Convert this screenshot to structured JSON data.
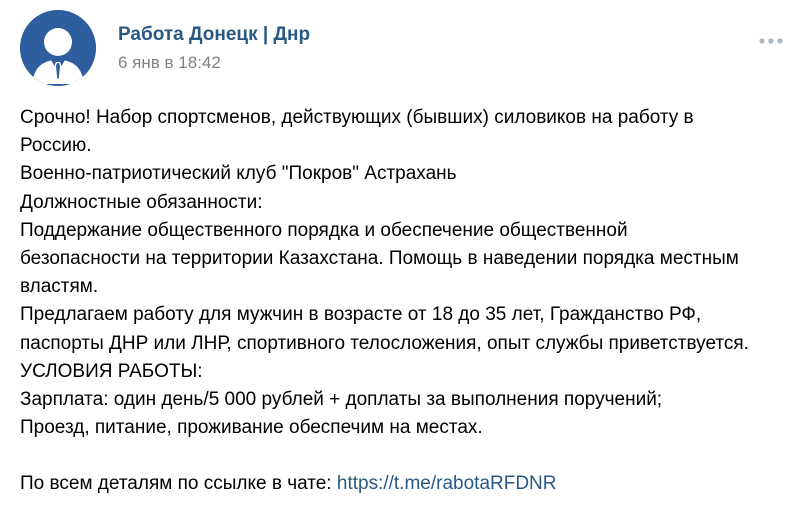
{
  "post": {
    "author": "Работа Донецк | Днр",
    "date": "6 янв в 18:42",
    "avatar_icon": "businessman-icon",
    "more_icon": "more-dots-icon",
    "text_lines": [
      "Срочно! Набор спортсменов, действующих (бывших) силовиков на работу в",
      "Россию.",
      "Военно-патриотический клуб \"Покров\" Астрахань",
      "Должностные обязанности:",
      "Поддержание общественного порядка и обеспечение общественной",
      "безопасности на территории Казахстана. Помощь в наведении порядка местным",
      "властям.",
      "Предлагаем работу для мужчин в возрасте от 18 до 35 лет, Гражданство РФ,",
      "паспорты ДНР или ЛНР, спортивного телосложения, опыт службы приветствуется.",
      "УСЛОВИЯ РАБОТЫ:",
      "Зарплата: один день/5 000 рублей + доплаты за выполнения поручений;",
      "Проезд, питание, проживание обеспечим на местах."
    ],
    "footer_prefix": "По всем деталям по ссылке в чате: ",
    "link": "https://t.me/rabotaRFDNR"
  },
  "colors": {
    "author": "#2a5885",
    "link": "#2a5885",
    "date": "#828282",
    "avatar_bg": "#2f5e9e",
    "text": "#000000"
  }
}
